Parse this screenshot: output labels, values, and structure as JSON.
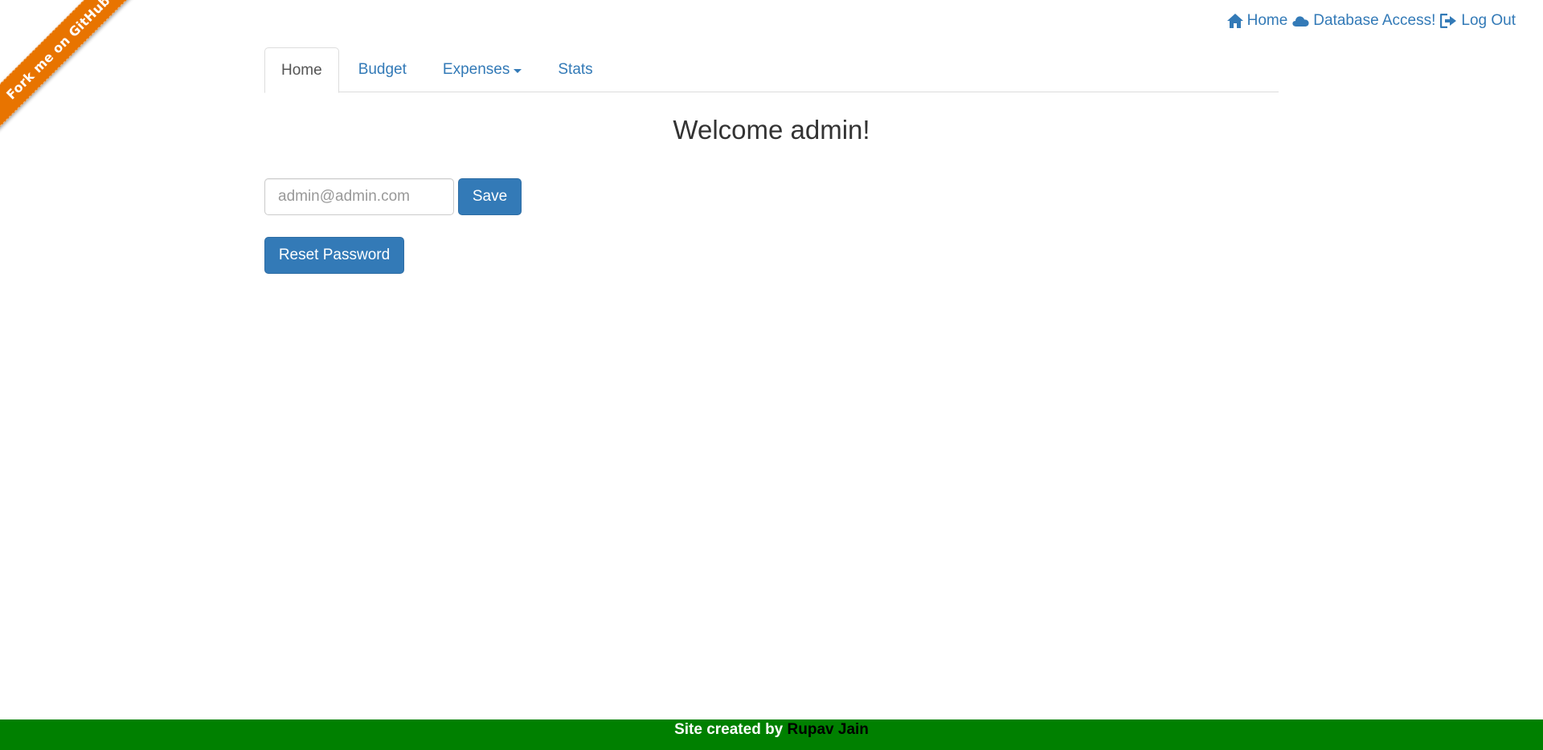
{
  "ribbon": {
    "label": "Fork me on GitHub",
    "color": "#e87400"
  },
  "top_links": {
    "home": {
      "label": "Home",
      "icon": "home-icon"
    },
    "database": {
      "label": "Database Access!",
      "icon": "cloud-icon"
    },
    "logout": {
      "label": "Log Out",
      "icon": "logout-icon"
    }
  },
  "tabs": [
    {
      "label": "Home",
      "active": true
    },
    {
      "label": "Budget",
      "active": false
    },
    {
      "label": "Expenses",
      "active": false,
      "dropdown": true
    },
    {
      "label": "Stats",
      "active": false
    }
  ],
  "main": {
    "welcome": "Welcome admin!",
    "email_placeholder": "admin@admin.com",
    "email_value": "",
    "save_label": "Save",
    "reset_label": "Reset Password"
  },
  "footer": {
    "prefix": "Site created by ",
    "author": "Rupav Jain",
    "color": "#008000"
  },
  "colors": {
    "link": "#337ab7",
    "button": "#337ab7"
  }
}
